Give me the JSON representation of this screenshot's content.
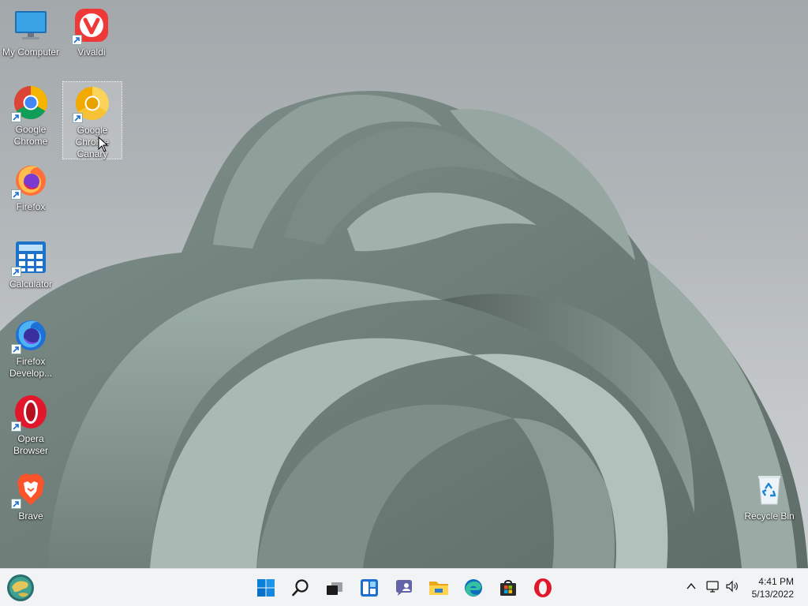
{
  "desktop": {
    "icons": [
      {
        "name": "my-computer",
        "label": "My Computer",
        "icon": "monitor-icon",
        "shortcut": false,
        "selected": false
      },
      {
        "name": "vivaldi",
        "label": "Vivaldi",
        "icon": "vivaldi-icon",
        "shortcut": true,
        "selected": false
      },
      {
        "name": "google-chrome",
        "label": "Google\nChrome",
        "icon": "chrome-icon",
        "shortcut": true,
        "selected": false
      },
      {
        "name": "google-chrome-canary",
        "label": "Google\nChrome\nCanary",
        "icon": "chrome-canary-icon",
        "shortcut": true,
        "selected": true
      },
      {
        "name": "firefox",
        "label": "Firefox",
        "icon": "firefox-icon",
        "shortcut": true,
        "selected": false
      },
      {
        "name": "calculator",
        "label": "Calculator",
        "icon": "calculator-icon",
        "shortcut": true,
        "selected": false
      },
      {
        "name": "firefox-developer",
        "label": "Firefox\nDevelop...",
        "icon": "firefox-developer-icon",
        "shortcut": true,
        "selected": false
      },
      {
        "name": "opera-browser",
        "label": "Opera\nBrowser",
        "icon": "opera-icon",
        "shortcut": true,
        "selected": false
      },
      {
        "name": "brave",
        "label": "Brave",
        "icon": "brave-icon",
        "shortcut": true,
        "selected": false
      },
      {
        "name": "recycle-bin",
        "label": "Recycle Bin",
        "icon": "recycle-bin-icon",
        "shortcut": false,
        "selected": false
      }
    ]
  },
  "taskbar": {
    "left": [
      {
        "name": "widgets",
        "icon": "globe-icon"
      }
    ],
    "center": [
      {
        "name": "start",
        "icon": "windows-start-icon"
      },
      {
        "name": "search",
        "icon": "search-icon"
      },
      {
        "name": "task-view",
        "icon": "task-view-icon"
      },
      {
        "name": "widgets-board",
        "icon": "widgets-icon"
      },
      {
        "name": "chat",
        "icon": "teams-chat-icon"
      },
      {
        "name": "file-explorer",
        "icon": "folder-icon"
      },
      {
        "name": "edge",
        "icon": "edge-icon"
      },
      {
        "name": "store",
        "icon": "store-icon"
      },
      {
        "name": "opera",
        "icon": "opera-icon"
      }
    ],
    "tray": {
      "icons": [
        "chevron-up-icon",
        "network-icon",
        "volume-icon"
      ],
      "time": "4:41 PM",
      "date": "5/13/2022"
    }
  },
  "colors": {
    "taskbar_bg": "#f1f3f5",
    "accent": "#0078d4"
  }
}
